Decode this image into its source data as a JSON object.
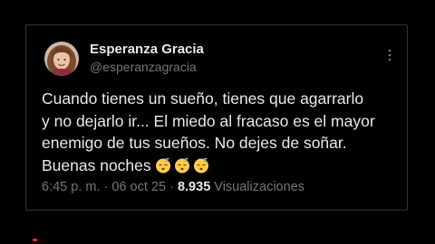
{
  "post": {
    "author_name": "Esperanza Gracia",
    "author_handle": "@esperanzagracia",
    "text_lines": [
      "Cuando tienes un sueño, tienes que agarrarlo",
      "y no dejarlo ir... El miedo al fracaso es el mayor",
      "enemigo de tus sueños. No dejes de soñar.",
      "Buenas noches"
    ],
    "emojis": [
      "sleeping-face-icon",
      "sleeping-face-icon",
      "sleeping-face-icon"
    ],
    "time": "6:45 p. m.",
    "separator": "·",
    "date": "06 oct 25",
    "views_count": "8.935",
    "views_label": "Visualizaciones"
  },
  "colors": {
    "background": "#000000",
    "text_primary": "#e7e9ea",
    "text_secondary": "#71767b",
    "border": "#2f3336",
    "emoji": "#ffcc4d"
  }
}
